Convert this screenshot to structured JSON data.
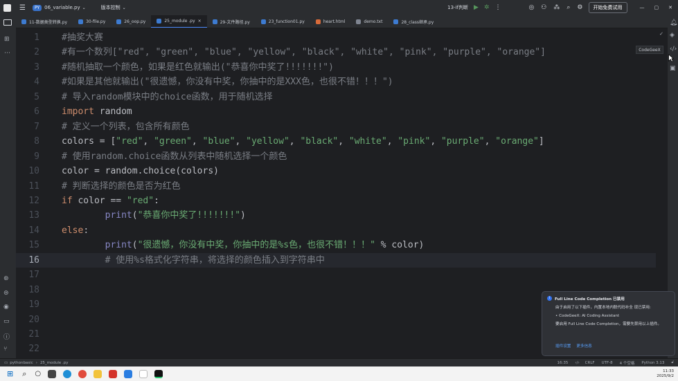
{
  "topbar": {
    "project_badge": "PY",
    "file": "06_variable.py",
    "vcs": "版本控制",
    "run_config": "13-if判断",
    "trial_button": "开始免费试用"
  },
  "tabs": [
    {
      "label": "11-数据类型转换.py"
    },
    {
      "label": "30-file.py"
    },
    {
      "label": "26_oop.py"
    },
    {
      "label": "25_module .py",
      "active": true
    },
    {
      "label": "29-文件路径.py"
    },
    {
      "label": "23_function01.py"
    },
    {
      "label": "heart.html"
    },
    {
      "label": "demo.txt"
    },
    {
      "label": "28_class继承.py"
    }
  ],
  "lines": [
    {
      "n": "1",
      "segs": [
        [
          "c",
          "#抽奖大赛"
        ]
      ]
    },
    {
      "n": "2",
      "segs": [
        [
          "c",
          "#有一个数列[\"red\", \"green\", \"blue\", \"yellow\", \"black\", \"white\", \"pink\", \"purple\", \"orange\"]"
        ]
      ]
    },
    {
      "n": "3",
      "segs": [
        [
          "c",
          "#随机抽取一个颜色，如果是红色就输出(\"恭喜你中奖了!!!!!!!\")"
        ]
      ]
    },
    {
      "n": "4",
      "segs": [
        [
          "c",
          "#如果是其他就输出(\"很遗憾，你没有中奖，你抽中的是XXX色，也很不错！！！\")"
        ]
      ]
    },
    {
      "n": "5",
      "segs": [
        [
          "c",
          "# 导入random模块中的choice函数，用于随机选择"
        ]
      ]
    },
    {
      "n": "6",
      "segs": [
        [
          "k",
          "import"
        ],
        [
          "p",
          " random"
        ]
      ]
    },
    {
      "n": "7",
      "segs": [
        [
          "c",
          "# 定义一个列表，包含所有颜色"
        ]
      ]
    },
    {
      "n": "8",
      "segs": [
        [
          "p",
          "colors = ["
        ],
        [
          "s",
          "\"red\""
        ],
        [
          "p",
          ", "
        ],
        [
          "s",
          "\"green\""
        ],
        [
          "p",
          ", "
        ],
        [
          "s",
          "\"blue\""
        ],
        [
          "p",
          ", "
        ],
        [
          "s",
          "\"yellow\""
        ],
        [
          "p",
          ", "
        ],
        [
          "s",
          "\"black\""
        ],
        [
          "p",
          ", "
        ],
        [
          "s",
          "\"white\""
        ],
        [
          "p",
          ", "
        ],
        [
          "s",
          "\"pink\""
        ],
        [
          "p",
          ", "
        ],
        [
          "s",
          "\"purple\""
        ],
        [
          "p",
          ", "
        ],
        [
          "s",
          "\"orange\""
        ],
        [
          "p",
          "]"
        ]
      ]
    },
    {
      "n": "9",
      "segs": [
        [
          "c",
          "# 使用random.choice函数从列表中随机选择一个颜色"
        ]
      ]
    },
    {
      "n": "10",
      "segs": [
        [
          "p",
          "color = random.choice(colors)"
        ]
      ]
    },
    {
      "n": "11",
      "segs": [
        [
          "c",
          "# 判断选择的颜色是否为红色"
        ]
      ]
    },
    {
      "n": "12",
      "segs": [
        [
          "k",
          "if"
        ],
        [
          "p",
          " color == "
        ],
        [
          "s",
          "\"red\""
        ],
        [
          "p",
          ":"
        ]
      ]
    },
    {
      "n": "13",
      "segs": [
        [
          "p",
          "        "
        ],
        [
          "b",
          "print"
        ],
        [
          "p",
          "("
        ],
        [
          "s",
          "\"恭喜你中奖了!!!!!!!\""
        ],
        [
          "p",
          ")"
        ]
      ]
    },
    {
      "n": "14",
      "segs": [
        [
          "k",
          "else"
        ],
        [
          "p",
          ":"
        ]
      ]
    },
    {
      "n": "15",
      "segs": [
        [
          "p",
          "        "
        ],
        [
          "b",
          "print"
        ],
        [
          "p",
          "("
        ],
        [
          "s",
          "\"很遗憾，你没有中奖，你抽中的是%s色，也很不错！！！\""
        ],
        [
          "p",
          " % color)"
        ]
      ]
    },
    {
      "n": "16",
      "segs": [
        [
          "p",
          "        "
        ],
        [
          "c",
          "# 使用%s格式化字符串，将选择的颜色插入到字符串中"
        ]
      ],
      "current": true
    },
    {
      "n": "17",
      "segs": []
    },
    {
      "n": "18",
      "segs": []
    },
    {
      "n": "19",
      "segs": []
    },
    {
      "n": "20",
      "segs": []
    },
    {
      "n": "21",
      "segs": []
    },
    {
      "n": "22",
      "segs": []
    }
  ],
  "tooltip": "CodeGeeX",
  "notification": {
    "title": "Full Line Code Completion 已禁用",
    "body1": "由于启用了以下插件，内置本地内联代码补全 现已禁用:",
    "bullet": "• CodeGeeX: AI Coding Assistant",
    "body2": "要启用 Full Line Code Completion，需要先禁用以上插件。",
    "link1": "插件设置",
    "link2": "更多信息"
  },
  "status": {
    "breadcrumb1": "pythonbasic",
    "breadcrumb2": "25_module .py",
    "position": "16:35",
    "eol": "CRLF",
    "encoding": "UTF-8",
    "indent": "4 个空格",
    "python": "Python 3.13"
  },
  "taskbar": {
    "time": "11:33",
    "date": "2025/9/2"
  },
  "colors": {
    "editor_bg": "#1e1f22",
    "comment": "#7a7e85",
    "keyword": "#cf8e6d",
    "string": "#6aab73",
    "builtin": "#8888c6"
  }
}
